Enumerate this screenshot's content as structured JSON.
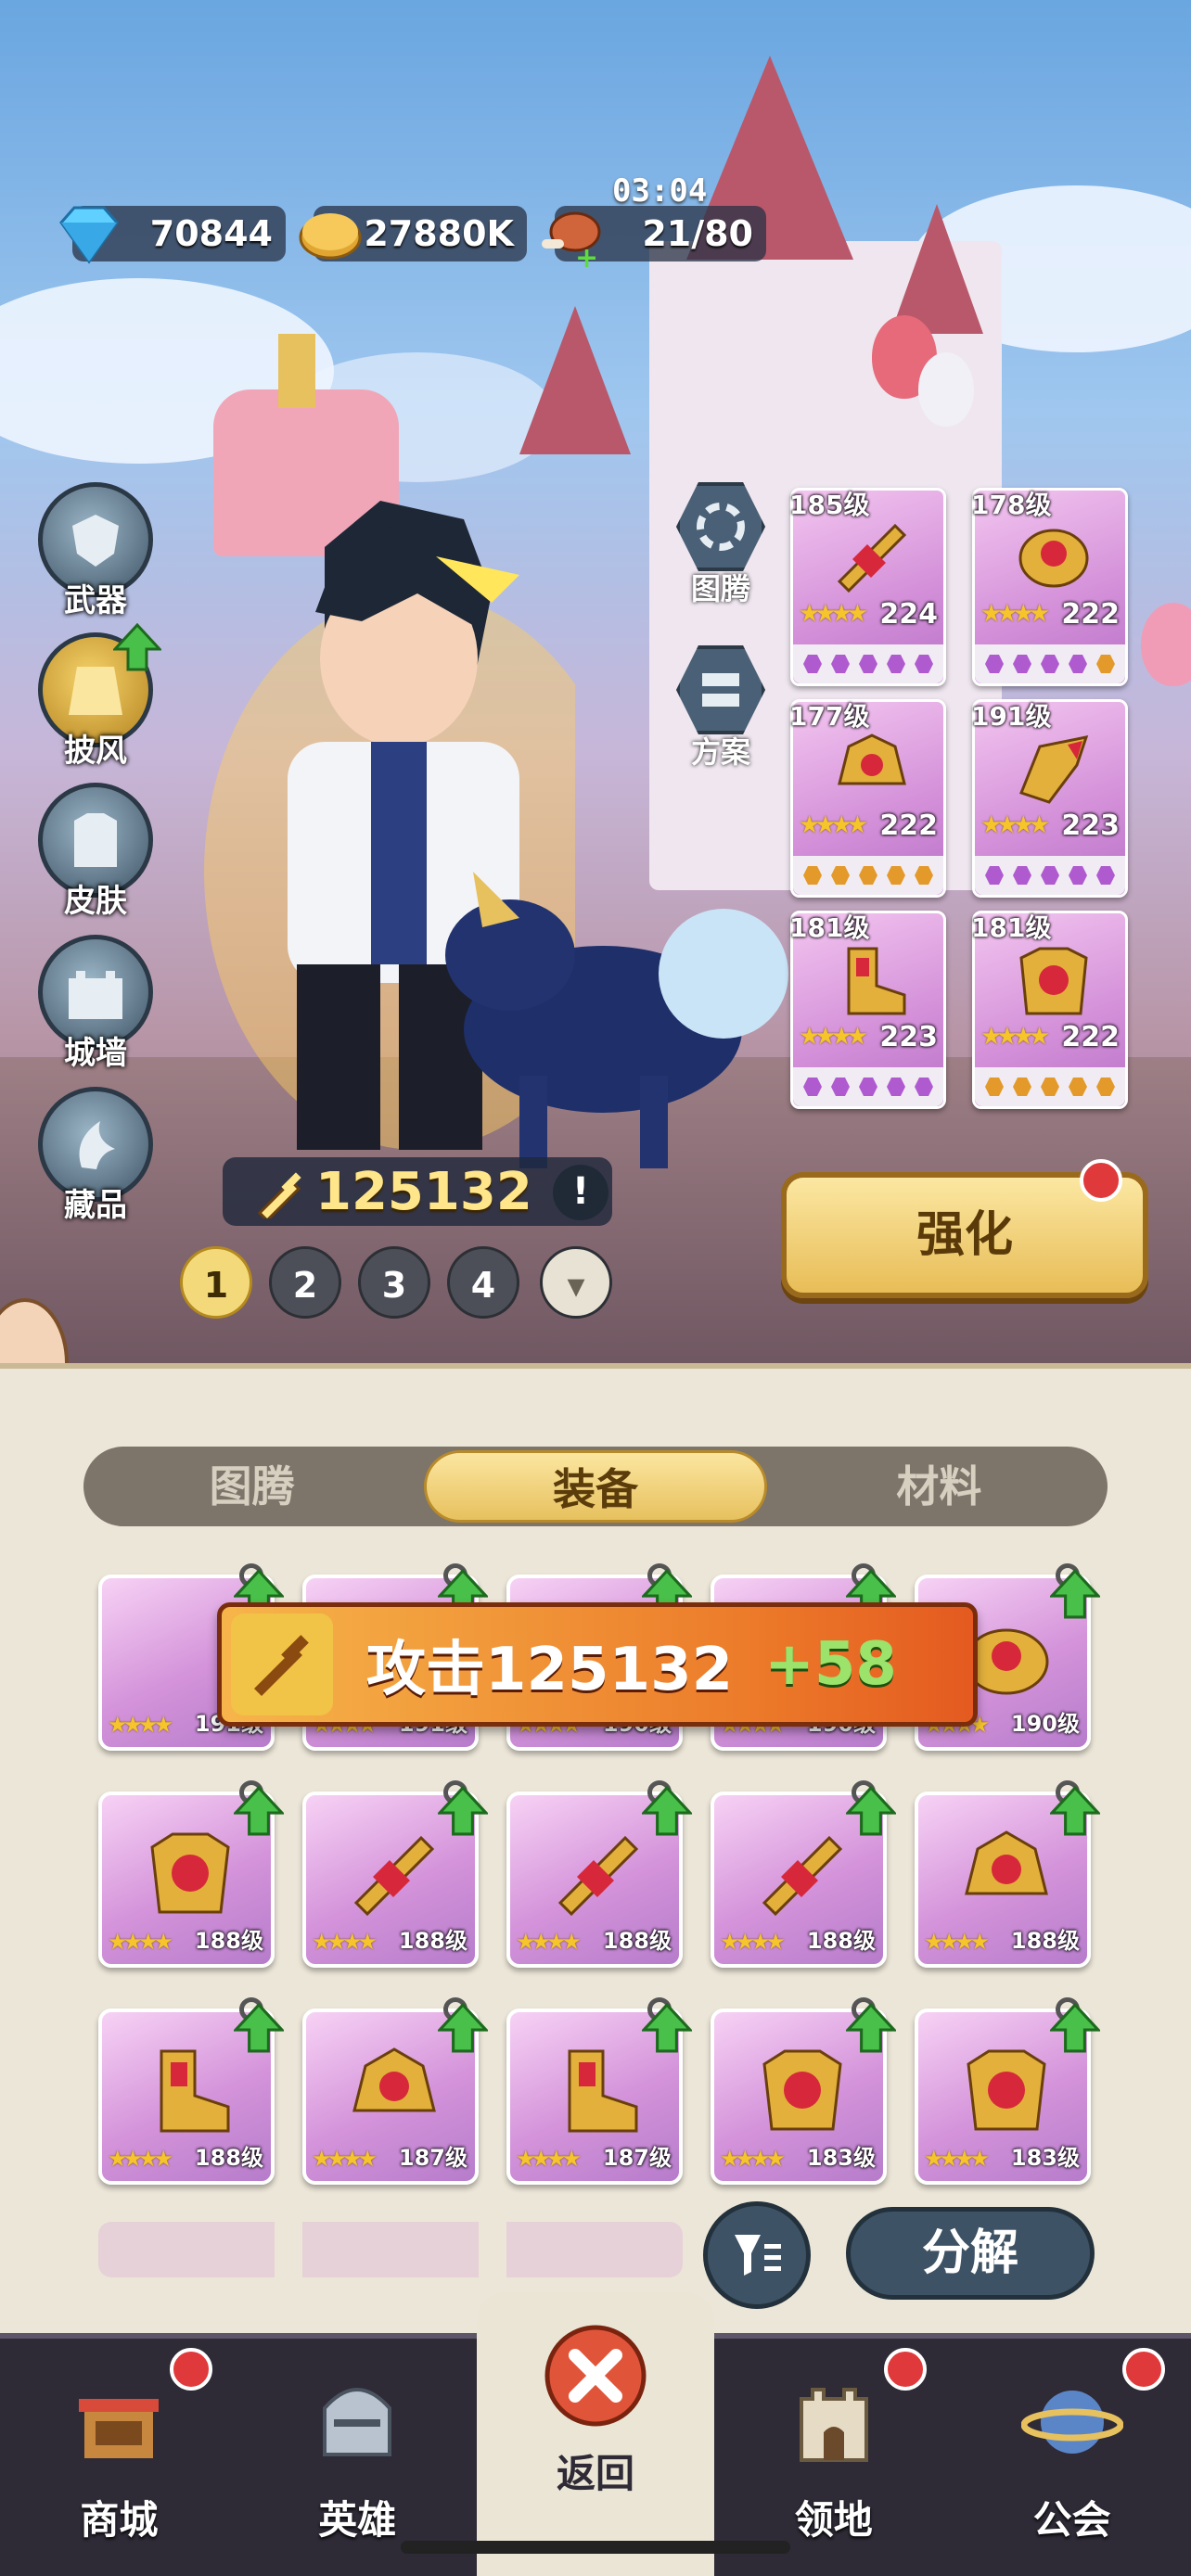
{
  "status": {
    "timer": "03:04"
  },
  "resources": {
    "diamond": "70844",
    "gold": "27880K",
    "stamina": "21/80"
  },
  "left_menu": [
    "武器",
    "披风",
    "皮肤",
    "城墙",
    "藏品"
  ],
  "mid_buttons": [
    "图腾",
    "方案"
  ],
  "equipped": [
    {
      "level": "185级",
      "power": "224"
    },
    {
      "level": "178级",
      "power": "222"
    },
    {
      "level": "177级",
      "power": "222"
    },
    {
      "level": "191级",
      "power": "223"
    },
    {
      "level": "181级",
      "power": "223"
    },
    {
      "level": "181级",
      "power": "222"
    }
  ],
  "power": "125132",
  "info_mark": "!",
  "pages": [
    "1",
    "2",
    "3",
    "4"
  ],
  "dropdown_glyph": "▾",
  "strengthen_label": "强化",
  "tabs": [
    "图腾",
    "装备",
    "材料"
  ],
  "toast": {
    "text": "攻击125132",
    "plus": "+58"
  },
  "inventory": [
    {
      "level": "191级"
    },
    {
      "level": "191级"
    },
    {
      "level": "190级"
    },
    {
      "level": "190级"
    },
    {
      "level": "190级"
    },
    {
      "level": "188级"
    },
    {
      "level": "188级"
    },
    {
      "level": "188级"
    },
    {
      "level": "188级"
    },
    {
      "level": "188级"
    },
    {
      "level": "188级"
    },
    {
      "level": "187级"
    },
    {
      "level": "187级"
    },
    {
      "level": "183级"
    },
    {
      "level": "183级"
    }
  ],
  "decompose_label": "分解",
  "nav": [
    "商城",
    "英雄",
    "返回",
    "领地",
    "公会"
  ],
  "colors": {
    "accent": "#e7c15e",
    "badge": "#e0393b",
    "card": "#d493da"
  }
}
